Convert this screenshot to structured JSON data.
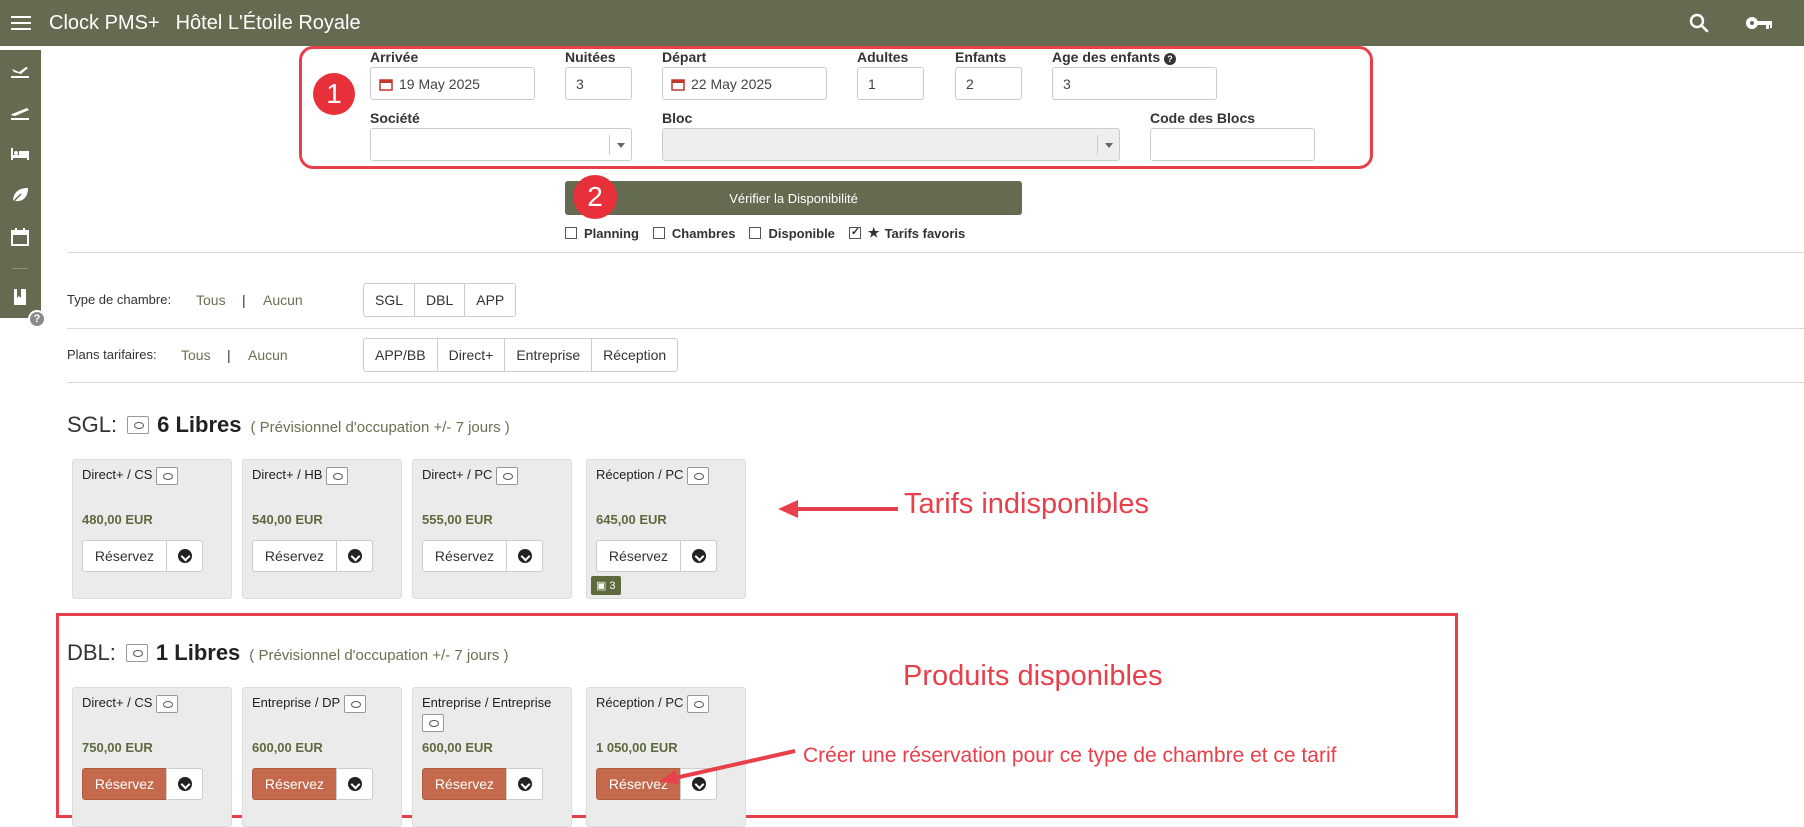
{
  "header": {
    "app_name": "Clock PMS+",
    "hotel_name": "Hôtel L'Étoile Royale"
  },
  "search": {
    "arrival_label": "Arrivée",
    "arrival_value": "19 May 2025",
    "nights_label": "Nuitées",
    "nights_value": "3",
    "departure_label": "Départ",
    "departure_value": "22 May 2025",
    "adults_label": "Adultes",
    "adults_value": "1",
    "children_label": "Enfants",
    "children_value": "2",
    "children_age_label": "Age des enfants",
    "children_age_value": "3",
    "company_label": "Société",
    "block_label": "Bloc",
    "block_code_label": "Code des Blocs"
  },
  "actions": {
    "check_availability": "Vérifier la Disponibilité"
  },
  "options": [
    {
      "label": "Planning",
      "checked": false
    },
    {
      "label": "Chambres",
      "checked": false
    },
    {
      "label": "Disponible",
      "checked": false
    },
    {
      "label": "Tarifs favoris",
      "checked": true
    }
  ],
  "filters": {
    "room_type": {
      "label": "Type de chambre:",
      "all": "Tous",
      "none": "Aucun",
      "sep": "|",
      "options": [
        "SGL",
        "DBL",
        "APP"
      ]
    },
    "rate_plans": {
      "label": "Plans tarifaires:",
      "all": "Tous",
      "none": "Aucun",
      "sep": "|",
      "options": [
        "APP/BB",
        "Direct+",
        "Entreprise",
        "Réception"
      ]
    }
  },
  "sections": [
    {
      "type": "SGL:",
      "free": "6 Libres",
      "forecast": "( Prévisionnel d'occupation +/- 7 jours )",
      "rates": [
        {
          "name": "Direct+ / CS",
          "price": "480,00 EUR",
          "button": "Réservez",
          "available": false
        },
        {
          "name": "Direct+ / HB",
          "price": "540,00 EUR",
          "button": "Réservez",
          "available": false
        },
        {
          "name": "Direct+ / PC",
          "price": "555,00 EUR",
          "button": "Réservez",
          "available": false
        },
        {
          "name": "Réception / PC",
          "price": "645,00 EUR",
          "button": "Réservez",
          "available": false,
          "tag": "3"
        }
      ]
    },
    {
      "type": "DBL:",
      "free": "1 Libres",
      "forecast": "( Prévisionnel d'occupation +/- 7 jours )",
      "rates": [
        {
          "name": "Direct+ / CS",
          "price": "750,00 EUR",
          "button": "Réservez",
          "available": true
        },
        {
          "name": "Entreprise / DP",
          "price": "600,00 EUR",
          "button": "Réservez",
          "available": true
        },
        {
          "name": "Entreprise / Entreprise",
          "price": "600,00 EUR",
          "button": "Réservez",
          "available": true
        },
        {
          "name": "Réception / PC",
          "price": "1 050,00 EUR",
          "button": "Réservez",
          "available": true
        }
      ]
    }
  ],
  "annotations": {
    "badge_1": "1",
    "badge_2": "2",
    "unavailable": "Tarifs indisponibles",
    "available": "Produits disponibles",
    "create_booking": "Créer une réservation pour ce type de chambre et ce tarif"
  },
  "colors": {
    "header": "#646b50",
    "accent_green": "#5c6a3e",
    "reserve_available": "#c4694c",
    "annotation_red": "#e8404b"
  },
  "icons": [
    "menu-icon",
    "search-icon",
    "key-icon",
    "arrival-icon",
    "departure-icon",
    "bed-icon",
    "leaf-icon",
    "calendar-icon",
    "book-icon",
    "help-icon"
  ]
}
